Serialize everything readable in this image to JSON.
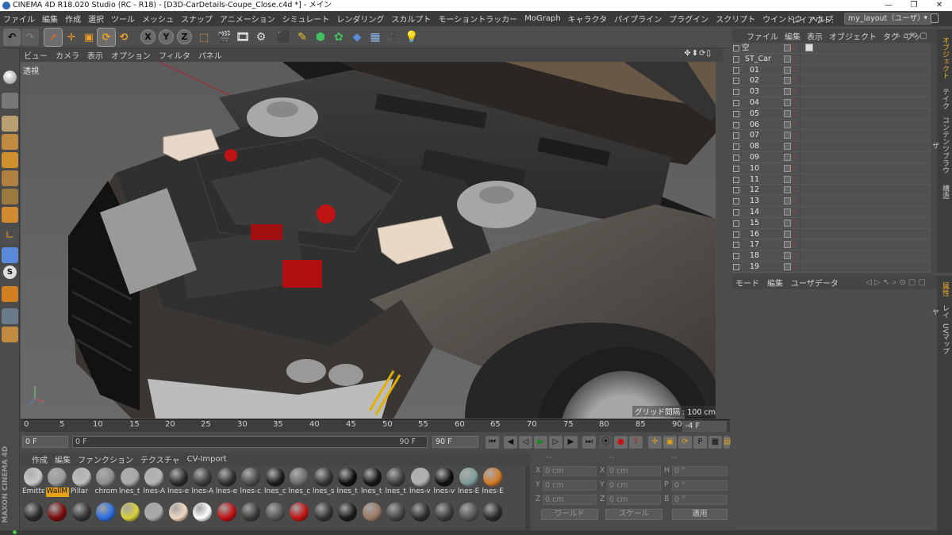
{
  "window": {
    "title": "CINEMA 4D R18.020 Studio (RC - R18) - [D3D-CarDetails-Coupe_Close.c4d *] - メイン",
    "controls": [
      "—",
      "❐",
      "✕"
    ]
  },
  "menubar": {
    "items": [
      "ファイル",
      "編集",
      "作成",
      "選択",
      "ツール",
      "メッシュ",
      "スナップ",
      "アニメーション",
      "シミュレート",
      "レンダリング",
      "スカルプト",
      "モーショントラッカー",
      "MoGraph",
      "キャラクタ",
      "パイプライン",
      "プラグイン",
      "スクリプト",
      "ウインドウ",
      "ヘルプ"
    ],
    "layout_label": "レイアウト:",
    "layout_value": "my_layout（ユーザ）"
  },
  "toolbar": {
    "axis_x": "X",
    "axis_y": "Y",
    "axis_z": "Z"
  },
  "viewport": {
    "menu": [
      "ビュー",
      "カメラ",
      "表示",
      "オプション",
      "フィルタ",
      "パネル"
    ],
    "nav_icons": "✥⬍⟳▯",
    "camera_label": "透視",
    "grid_note": "グリッド間隔 : 100 cm"
  },
  "timeline": {
    "ticks": [
      "0",
      "5",
      "10",
      "15",
      "20",
      "25",
      "30",
      "35",
      "40",
      "45",
      "50",
      "55",
      "60",
      "65",
      "70",
      "75",
      "80",
      "85",
      "90"
    ],
    "current_frame": "-4 F",
    "start_field": "0 F",
    "slider_start": "0 F",
    "slider_end": "90 F",
    "end_field": "90 F"
  },
  "material_manager": {
    "menu": [
      "作成",
      "編集",
      "ファンクション",
      "テクスチャ",
      "CV-Import"
    ],
    "row1": [
      {
        "label": "Emitte",
        "color": "#c9c9c9"
      },
      {
        "label": "WallM",
        "color": "#9a9a9a",
        "highlight": true
      },
      {
        "label": "Pillar",
        "color": "#bdbdbd"
      },
      {
        "label": "chrom",
        "color": "#8e8e8e"
      },
      {
        "label": "lnes_t",
        "color": "#a9a9a9"
      },
      {
        "label": "lnes-A",
        "color": "#b5b5b5"
      },
      {
        "label": "lnes-e",
        "color": "#2a2a2a"
      },
      {
        "label": "lnes-A",
        "color": "#3a3a3a"
      },
      {
        "label": "lnes-e",
        "color": "#2f2f2f"
      },
      {
        "label": "lnes-c",
        "color": "#4a4a4a"
      },
      {
        "label": "lnes_c",
        "color": "#1c1c1c"
      },
      {
        "label": "lnes_c",
        "color": "#6a6a6a"
      },
      {
        "label": "lnes_s",
        "color": "#333"
      },
      {
        "label": "lnes_t",
        "color": "#0e0e0e"
      },
      {
        "label": "lnes_t",
        "color": "#141414"
      },
      {
        "label": "lnes_t",
        "color": "#3d3d3d"
      },
      {
        "label": "lnes-v",
        "color": "#b0b0b0"
      },
      {
        "label": "lnes-v",
        "color": "#0f0f0f"
      },
      {
        "label": "lnes-E",
        "color": "#7d9a98"
      },
      {
        "label": "lnes-E",
        "color": "#d07a26"
      }
    ],
    "row2": [
      "#2a2a2a",
      "#7a0a0a",
      "#333",
      "#2a6ee0",
      "#d8d23a",
      "#aaaaaa",
      "#f0d8c0",
      "#ffffff",
      "#c01010",
      "#3a3a3a",
      "#555555",
      "#c21212",
      "#333",
      "#1a1a1a",
      "#9a7a64",
      "#444",
      "#2d2d2d",
      "#3a3a3a",
      "#555",
      "#2a2a2a"
    ]
  },
  "coordinates": {
    "headers": [
      "--",
      "--",
      "--"
    ],
    "rows": [
      {
        "a": "X",
        "av": "0 cm",
        "b": "X",
        "bv": "0 cm",
        "c": "H",
        "cv": "0 °"
      },
      {
        "a": "Y",
        "av": "0 cm",
        "b": "Y",
        "bv": "0 cm",
        "c": "P",
        "cv": "0 °"
      },
      {
        "a": "Z",
        "av": "0 cm",
        "b": "Z",
        "bv": "0 cm",
        "c": "B",
        "cv": "0 °"
      }
    ],
    "mode1": "ワールド",
    "mode2": "スケール",
    "apply": "適用"
  },
  "object_manager": {
    "menu": [
      "ファイル",
      "編集",
      "表示",
      "オブジェクト",
      "タグ",
      "ブッ"
    ],
    "objects": [
      "空",
      "ST_Car",
      "01",
      "02",
      "03",
      "04",
      "05",
      "06",
      "07",
      "08",
      "09",
      "10",
      "11",
      "12",
      "13",
      "14",
      "15",
      "16",
      "17",
      "18",
      "19"
    ]
  },
  "right_tabs": [
    "オブジェクト",
    "テイク",
    "コンテンツブラウザ",
    "構造"
  ],
  "attributes": {
    "menu": [
      "モード",
      "編集",
      "ユーザデータ"
    ]
  },
  "right_tabs2": [
    "属性",
    "レイヤ",
    "UVマップ"
  ],
  "brand": "MAXON CINEMA 4D"
}
